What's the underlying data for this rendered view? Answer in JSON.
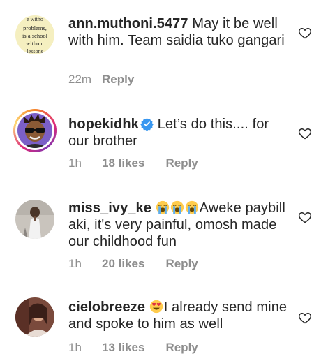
{
  "comments": [
    {
      "username": "ann.muthoni.5477",
      "text": "May it be well with him.  Team saidia tuko gangari",
      "time": "22m",
      "likes": "",
      "reply": "Reply",
      "avatar_text": "Life without problems, is a school without lessons",
      "verified": false
    },
    {
      "username": "hopekidhk",
      "text": "Let’s do this.... for our brother",
      "time": "1h",
      "likes": "18 likes",
      "reply": "Reply",
      "verified": true,
      "has_story_ring": true
    },
    {
      "username": "miss_ivy_ke",
      "emojis": [
        "loudly-crying-face",
        "loudly-crying-face",
        "loudly-crying-face"
      ],
      "text": "Aweke paybill aki, it's very painful, omosh made our childhood fun",
      "time": "1h",
      "likes": "20 likes",
      "reply": "Reply",
      "verified": false
    },
    {
      "username": "cielobreeze",
      "emojis": [
        "smiling-face-with-heart-eyes"
      ],
      "text": "I already send mine and spoke to him as well",
      "time": "1h",
      "likes": "13 likes",
      "reply": "Reply",
      "verified": false
    }
  ],
  "colors": {
    "text": "#262626",
    "meta": "#8e8e8e",
    "verified_blue": "#3897f0",
    "emoji_yellow": "#ffcc4d"
  }
}
